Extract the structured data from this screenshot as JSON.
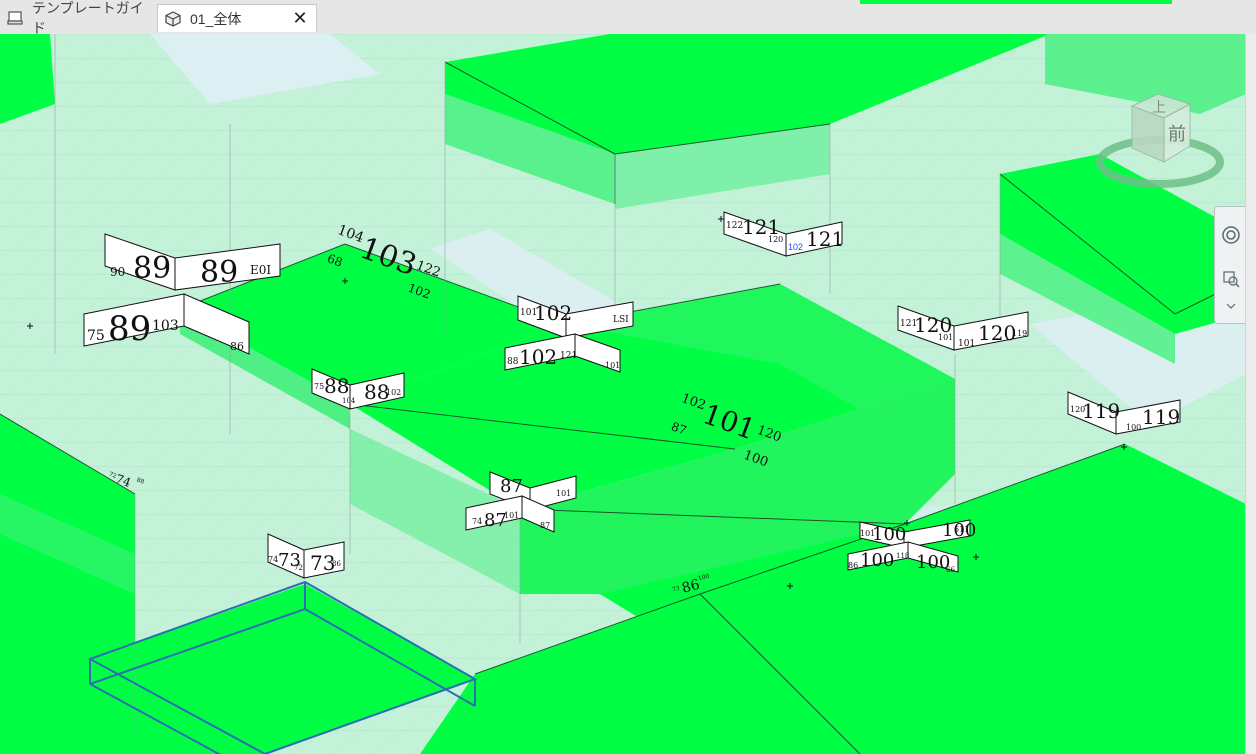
{
  "tabs": [
    {
      "label": "テンプレートガイド",
      "icon": "sheet-icon",
      "active": false
    },
    {
      "label": "01_全体",
      "icon": "3d-view-icon",
      "active": true,
      "close": "✕"
    }
  ],
  "viewcube": {
    "top_face": "上",
    "front_face": "前"
  },
  "elevation_tags": [
    {
      "id": "t89",
      "left": "90",
      "main": "89",
      "right": "E0I",
      "main2": "89",
      "left2": "75",
      "right2": "103",
      "tail": "86"
    },
    {
      "id": "t103",
      "top": "104",
      "main": "103",
      "right": "122",
      "sub": "102",
      "under": "68"
    },
    {
      "id": "t102",
      "left": "101",
      "main": "102",
      "right": "LSI",
      "left2": "88",
      "main2": "102",
      "right2": "121",
      "tail": "101"
    },
    {
      "id": "t121",
      "left": "122",
      "main": "121",
      "mid": "120",
      "blue": "102",
      "main2": "121"
    },
    {
      "id": "t88",
      "left": "75",
      "main": "88",
      "right": "102",
      "mid": "104"
    },
    {
      "id": "t120",
      "left": "121",
      "main": "120",
      "mid": "101",
      "main2": "120",
      "right": "119"
    },
    {
      "id": "t101",
      "top": "102",
      "main": "101",
      "right": "120",
      "sub": "100",
      "under": "87"
    },
    {
      "id": "t119",
      "left": "120",
      "main": "119",
      "mid": "100",
      "main2": "119"
    },
    {
      "id": "t87",
      "left": "74",
      "main": "87",
      "right": "101",
      "right2": "86",
      "tail": "87"
    },
    {
      "id": "t100",
      "left": "101",
      "main": "100",
      "right": "611",
      "left2": "86",
      "main2": "100",
      "mid": "118",
      "tail": "66"
    },
    {
      "id": "t73",
      "left": "74",
      "main": "73",
      "mid": "72",
      "main2": "73",
      "right": "86"
    },
    {
      "id": "t86",
      "main": "86",
      "left": "73",
      "right": "100"
    },
    {
      "id": "t74",
      "main": "74",
      "left": "72",
      "right": "88"
    }
  ]
}
